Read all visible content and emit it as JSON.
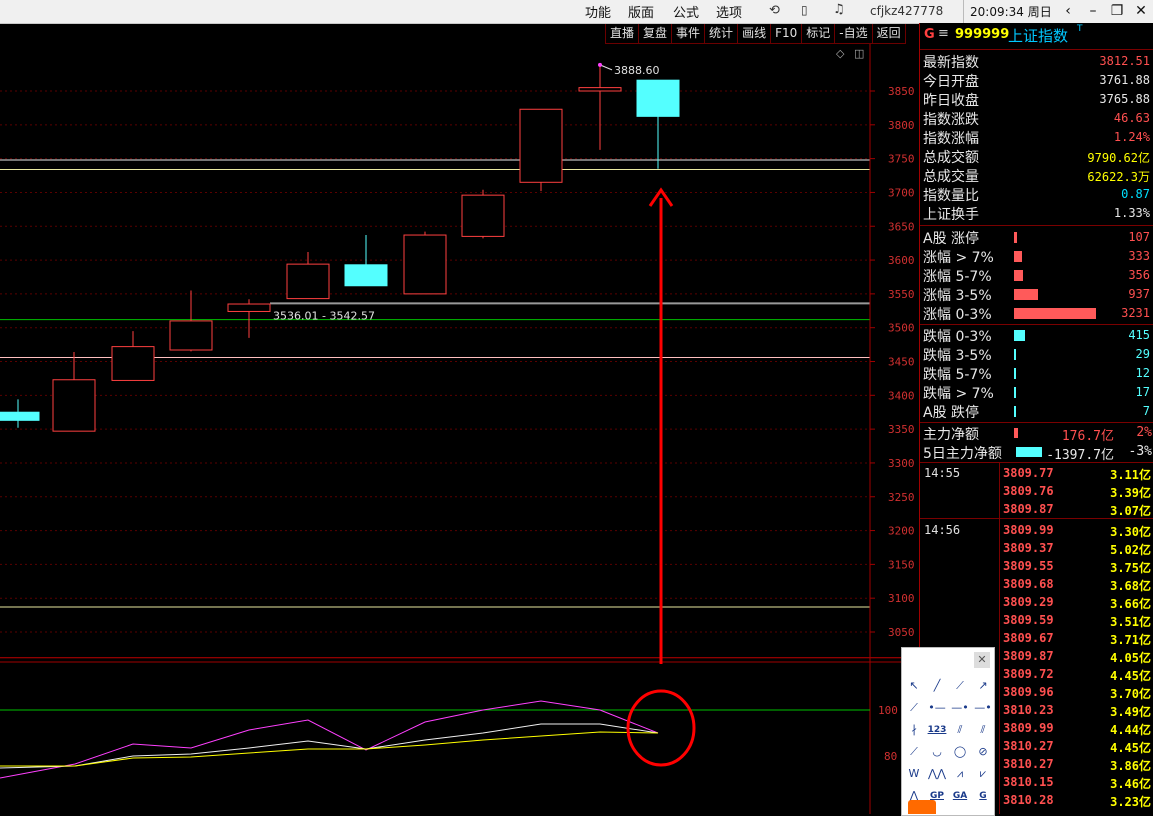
{
  "menu": [
    "功能",
    "版面",
    "公式",
    "选项"
  ],
  "user": "cfjkz427778",
  "clock": "20:09:34 周日",
  "toolbar": [
    "直播",
    "复盘",
    "事件",
    "统计",
    "画线",
    "F10",
    "标记",
    "-自选",
    "返回"
  ],
  "chart_data": {
    "type": "candlestick",
    "y_ticks": [
      "3850",
      "3800",
      "3750",
      "3700",
      "3650",
      "3600",
      "3550",
      "3500",
      "3450",
      "3400",
      "3350",
      "3300",
      "3250",
      "3200",
      "3150",
      "3100",
      "3050"
    ],
    "ylim": [
      3010,
      3885
    ],
    "candles": [
      {
        "open": 3375,
        "high": 3394,
        "low": 3352,
        "close": 3363
      },
      {
        "open": 3347,
        "high": 3464,
        "low": 3347,
        "close": 3423
      },
      {
        "open": 3422,
        "high": 3495,
        "low": 3422,
        "close": 3472
      },
      {
        "open": 3467,
        "high": 3555,
        "low": 3465,
        "close": 3510
      },
      {
        "open": 3524,
        "high": 3542,
        "low": 3485,
        "close": 3535
      },
      {
        "open": 3543,
        "high": 3612,
        "low": 3543,
        "close": 3594
      },
      {
        "open": 3593,
        "high": 3637,
        "low": 3565,
        "close": 3562
      },
      {
        "open": 3550,
        "high": 3642,
        "low": 3550,
        "close": 3637
      },
      {
        "open": 3635,
        "high": 3704,
        "low": 3632,
        "close": 3696
      },
      {
        "open": 3715,
        "high": 3822,
        "low": 3702,
        "close": 3823
      },
      {
        "open": 3850,
        "high": 3888.6,
        "low": 3763,
        "close": 3855
      },
      {
        "open": 3866,
        "high": 3866,
        "low": 3735,
        "close": 3812.51
      }
    ],
    "annotations": {
      "high_label": "3888.60",
      "range_label": "3536.01 - 3542.57"
    },
    "hlines": [
      3748,
      3734,
      3536,
      3512,
      3456,
      3087,
      3012
    ],
    "indicator_ticks": [
      "100",
      "80"
    ]
  },
  "panel": {
    "code": "999999",
    "name": "上证指数",
    "g": "G",
    "stats": [
      {
        "label": "最新指数",
        "value": "3812.51",
        "color": "#ff5050"
      },
      {
        "label": "今日开盘",
        "value": "3761.88",
        "color": "#e8e8e8"
      },
      {
        "label": "昨日收盘",
        "value": "3765.88",
        "color": "#e8e8e8"
      },
      {
        "label": "指数涨跌",
        "value": "46.63",
        "color": "#ff5050"
      },
      {
        "label": "指数涨幅",
        "value": "1.24%",
        "color": "#ff5050"
      },
      {
        "label": "总成交额",
        "value": "9790.62亿",
        "color": "#ffff00"
      },
      {
        "label": "总成交量",
        "value": "62622.3万",
        "color": "#ffff00"
      },
      {
        "label": "指数量比",
        "value": "0.87",
        "color": "#00e0ff"
      },
      {
        "label": "上证换手",
        "value": "1.33%",
        "color": "#e8e8e8"
      }
    ],
    "breadth_up": [
      {
        "label": "A股 涨停",
        "value": "107",
        "bar": 0.03
      },
      {
        "label": "涨幅 > 7%",
        "value": "333",
        "bar": 0.1
      },
      {
        "label": "涨幅 5-7%",
        "value": "356",
        "bar": 0.11
      },
      {
        "label": "涨幅 3-5%",
        "value": "937",
        "bar": 0.29
      },
      {
        "label": "涨幅 0-3%",
        "value": "3231",
        "bar": 1.0
      }
    ],
    "breadth_down": [
      {
        "label": "跌幅 0-3%",
        "value": "415",
        "bar": 0.13
      },
      {
        "label": "跌幅 3-5%",
        "value": "29",
        "bar": 0.01
      },
      {
        "label": "跌幅 5-7%",
        "value": "12",
        "bar": 0.01
      },
      {
        "label": "跌幅 > 7%",
        "value": "17",
        "bar": 0.01
      },
      {
        "label": "A股 跌停",
        "value": "7",
        "bar": 0.01
      }
    ],
    "flows": [
      {
        "label": "主力净额",
        "value": "176.7亿",
        "pct": "2%"
      },
      {
        "label": "5日主力净额",
        "value": "-1397.7亿",
        "pct": "-3%"
      }
    ],
    "ticks": [
      {
        "time": "14:55",
        "price": "3809.77",
        "amt": "3.11亿"
      },
      {
        "time": "",
        "price": "3809.76",
        "amt": "3.39亿"
      },
      {
        "time": "",
        "price": "3809.87",
        "amt": "3.07亿"
      },
      {
        "time": "14:56",
        "price": "3809.99",
        "amt": "3.30亿"
      },
      {
        "time": "",
        "price": "3809.37",
        "amt": "5.02亿"
      },
      {
        "time": "",
        "price": "3809.55",
        "amt": "3.75亿"
      },
      {
        "time": "",
        "price": "3809.68",
        "amt": "3.68亿"
      },
      {
        "time": "",
        "price": "3809.29",
        "amt": "3.66亿"
      },
      {
        "time": "",
        "price": "3809.59",
        "amt": "3.51亿"
      },
      {
        "time": "",
        "price": "3809.67",
        "amt": "3.71亿"
      },
      {
        "time": "",
        "price": "3809.87",
        "amt": "4.05亿"
      },
      {
        "time": "",
        "price": "3809.72",
        "amt": "4.45亿"
      },
      {
        "time": "",
        "price": "3809.96",
        "amt": "3.70亿"
      },
      {
        "time": "",
        "price": "3810.23",
        "amt": "3.49亿"
      },
      {
        "time": "",
        "price": "3809.99",
        "amt": "4.44亿"
      },
      {
        "time": "",
        "price": "3810.27",
        "amt": "4.45亿"
      },
      {
        "time": "",
        "price": "3810.27",
        "amt": "3.86亿"
      },
      {
        "time": "",
        "price": "3810.15",
        "amt": "3.46亿"
      },
      {
        "time": "",
        "price": "3810.28",
        "amt": "3.23亿"
      }
    ]
  },
  "drawtools": {
    "icons": [
      "cursor-icon",
      "line-icon",
      "ray-icon",
      "arrow-line-icon",
      "segment-icon",
      "dot-line-icon",
      "hline-icon",
      "hray-icon",
      "pencil-icon",
      "number-123-icon",
      "parallel-icon",
      "channel-icon",
      "fib-icon",
      "arc-icon",
      "circle-icon",
      "no-icon",
      "wave-w-icon",
      "wave-m-icon",
      "wave-up-icon",
      "wave-down-icon",
      "gann-icon",
      "gp-icon",
      "ga-icon",
      "g-icon"
    ],
    "labels": [
      "123",
      "GP",
      "GA",
      "G"
    ]
  }
}
